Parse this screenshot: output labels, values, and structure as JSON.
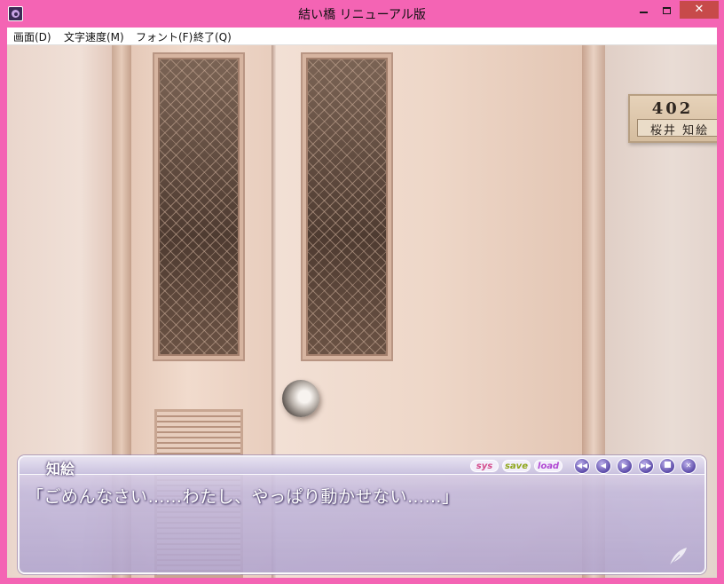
{
  "window": {
    "title": "結い橋 リニューアル版",
    "close_glyph": "✕"
  },
  "menu": {
    "items": [
      {
        "label": "画面(D)"
      },
      {
        "label": "文字速度(M)"
      },
      {
        "label": "フォント(F)"
      },
      {
        "label": "終了(Q)"
      }
    ]
  },
  "scene": {
    "nameplate": {
      "room": "402",
      "name": "桜井  知絵"
    }
  },
  "message": {
    "speaker": "知絵",
    "text": "「ごめんなさい……わたし、やっぱり動かせない……」",
    "buttons": {
      "sys": "sys",
      "save": "save",
      "load": "load"
    },
    "controls": {
      "rewind_glyph": "◀◀",
      "back_glyph": "◀",
      "play_glyph": "▶",
      "skip_glyph": "▶▶",
      "close_glyph": "✕"
    }
  }
}
